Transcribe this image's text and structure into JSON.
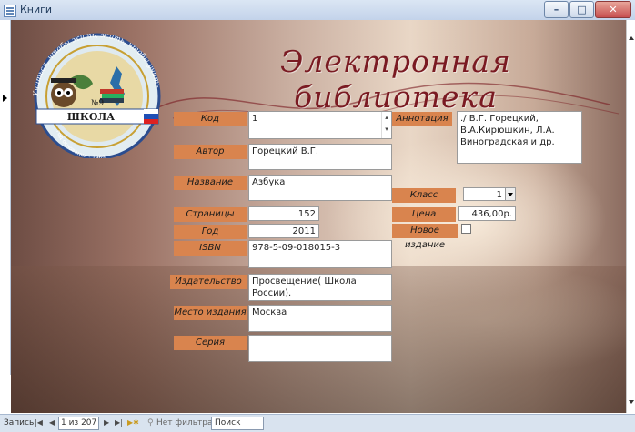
{
  "window": {
    "title": "Книги",
    "minimize": "–",
    "maximize": "□",
    "close": "✕"
  },
  "header": {
    "title": "Электронная библиотека"
  },
  "logo": {
    "motto": "Учиться, чтобы жить, жить, чтобы учить",
    "number": "№9",
    "school": "ШКОЛА",
    "founded": "год основания - 1969"
  },
  "labels": {
    "kod": "Код",
    "author": "Автор",
    "name": "Название",
    "pages": "Страницы",
    "year": "Год",
    "isbn": "ISBN",
    "publisher": "Издательство",
    "place": "Место издания",
    "series": "Серия",
    "annotation": "Аннотация",
    "klass": "Класс",
    "price": "Цена",
    "new_edition": "Новое издание"
  },
  "values": {
    "kod": "1",
    "author": "Горецкий В.Г.",
    "name": "Азбука",
    "pages": "152",
    "year": "2011",
    "isbn": "978-5-09-018015-3",
    "publisher": "Просвещение( Школа России).",
    "place": "Москва",
    "series": "",
    "annotation": "./ В.Г. Горецкий, В.А.Кирюшкин, Л.А. Виноградская и др.",
    "klass": "1",
    "price": "436,00р.",
    "new_edition": false
  },
  "status": {
    "record_label": "Запись:",
    "record_position": "1 из 207",
    "filter_label": "Нет фильтра",
    "search_placeholder": "Поиск"
  },
  "icons": [
    "table-icon",
    "first-record-icon",
    "prev-record-icon",
    "next-record-icon",
    "last-record-icon",
    "new-record-icon",
    "filter-icon"
  ]
}
